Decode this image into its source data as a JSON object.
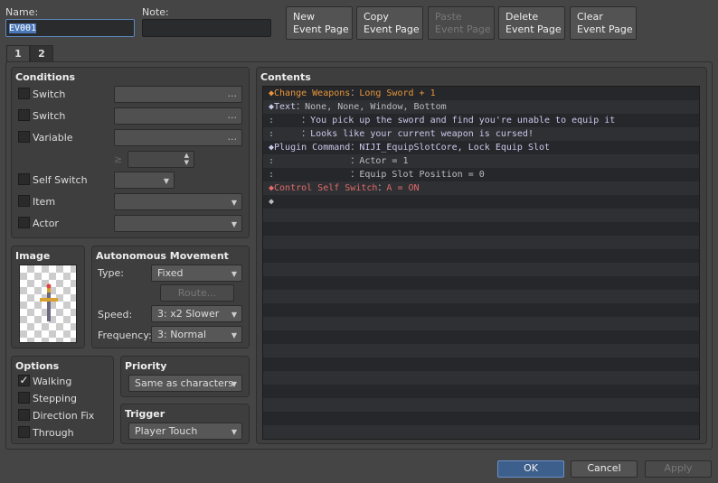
{
  "name": {
    "label": "Name:",
    "value": "EV001"
  },
  "note": {
    "label": "Note:",
    "value": ""
  },
  "toolbar": {
    "new": "New\nEvent Page",
    "copy": "Copy\nEvent Page",
    "paste": "Paste\nEvent Page",
    "delete": "Delete\nEvent Page",
    "clear": "Clear\nEvent Page"
  },
  "tabs": [
    "1",
    "2"
  ],
  "conditions": {
    "title": "Conditions",
    "switch1": "Switch",
    "switch2": "Switch",
    "variable": "Variable",
    "variable_op": "≥",
    "self_switch": "Self Switch",
    "item": "Item",
    "actor": "Actor",
    "ellipsis": "..."
  },
  "image": {
    "title": "Image"
  },
  "movement": {
    "title": "Autonomous Movement",
    "type_label": "Type:",
    "type": "Fixed",
    "route": "Route...",
    "speed_label": "Speed:",
    "speed": "3: x2 Slower",
    "freq_label": "Frequency:",
    "freq": "3: Normal"
  },
  "options": {
    "title": "Options",
    "items": [
      {
        "label": "Walking",
        "checked": true
      },
      {
        "label": "Stepping",
        "checked": false
      },
      {
        "label": "Direction Fix",
        "checked": false
      },
      {
        "label": "Through",
        "checked": false
      }
    ]
  },
  "priority": {
    "title": "Priority",
    "value": "Same as characters"
  },
  "trigger": {
    "title": "Trigger",
    "value": "Player Touch"
  },
  "contents": {
    "title": "Contents",
    "colors": {
      "weapon": "#e8963c",
      "text": "#c9c9ec",
      "plugin": "#c9c9ec",
      "self": "#e26a6a",
      "default": "#bcbcbc"
    },
    "rows": [
      {
        "head": "◆Change Weapons",
        "sep": "：",
        "body": "Long Sword + 1",
        "kind": "weapon"
      },
      {
        "head": "◆Text",
        "sep": "：",
        "body": "None, None, Window, Bottom",
        "kind": "text",
        "muted": true
      },
      {
        "head": ":     ",
        "sep": "：",
        "body": "You pick up the sword and find you're unable to equip it",
        "kind": "text"
      },
      {
        "head": ":     ",
        "sep": "：",
        "body": "Looks like your current weapon is cursed!",
        "kind": "text"
      },
      {
        "head": "◆Plugin Command",
        "sep": "：",
        "body": "NIJI_EquipSlotCore, Lock Equip Slot",
        "kind": "plugin"
      },
      {
        "head": ":              ",
        "sep": "：",
        "body": "Actor = 1",
        "kind": "plugin",
        "muted": true
      },
      {
        "head": ":              ",
        "sep": "：",
        "body": "Equip Slot Position = 0",
        "kind": "plugin",
        "muted": true
      },
      {
        "head": "◆Control Self Switch",
        "sep": "：",
        "body": "A = ON",
        "kind": "self"
      },
      {
        "head": "◆",
        "sep": "",
        "body": "",
        "kind": "default"
      }
    ]
  },
  "footer": {
    "ok": "OK",
    "cancel": "Cancel",
    "apply": "Apply"
  }
}
